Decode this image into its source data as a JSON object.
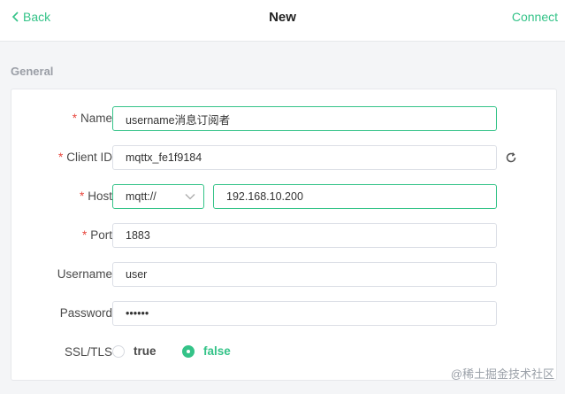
{
  "header": {
    "back_label": "Back",
    "title": "New",
    "connect_label": "Connect"
  },
  "section": {
    "title": "General"
  },
  "form": {
    "name": {
      "label": "Name",
      "required": "*",
      "value": "username消息订阅者"
    },
    "client_id": {
      "label": "Client ID",
      "required": "*",
      "value": "mqttx_fe1f9184"
    },
    "host": {
      "label": "Host",
      "required": "*",
      "protocol": "mqtt://",
      "value": "192.168.10.200"
    },
    "port": {
      "label": "Port",
      "required": "*",
      "value": "1883"
    },
    "username": {
      "label": "Username",
      "value": "user"
    },
    "password": {
      "label": "Password",
      "value": "••••••"
    },
    "ssl_tls": {
      "label": "SSL/TLS",
      "options": [
        "true",
        "false"
      ],
      "selected": "false"
    }
  },
  "watermark": "@稀土掘金技术社区",
  "colors": {
    "accent": "#34c388",
    "required": "#e8483f",
    "border": "#dcdfe6"
  }
}
